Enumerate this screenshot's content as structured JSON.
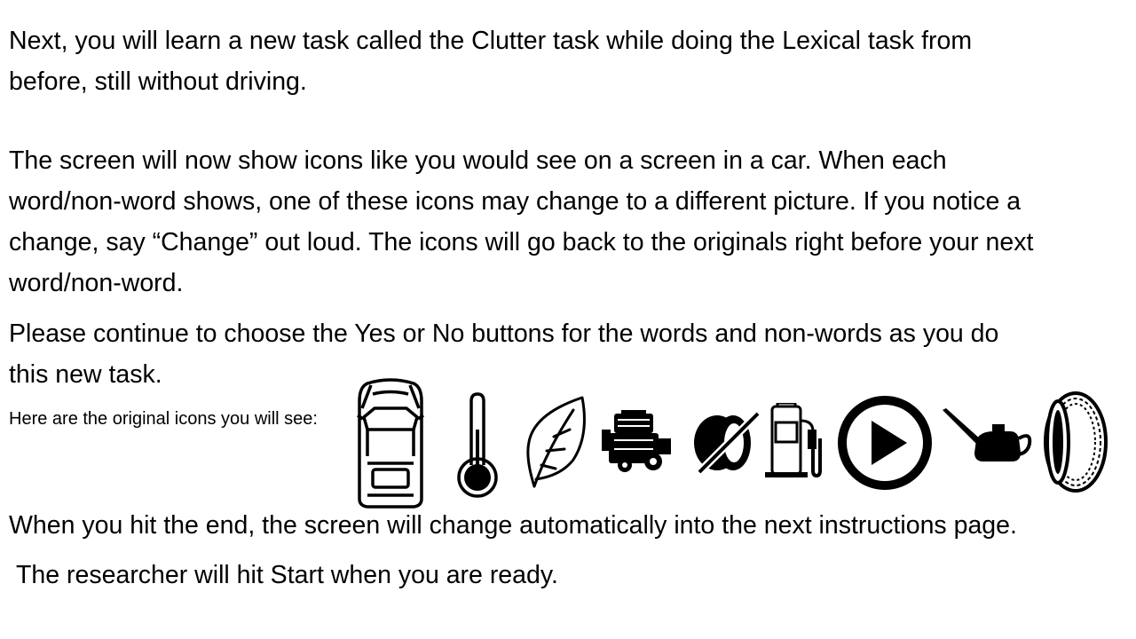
{
  "paragraphs": {
    "p1_line1": "Next, you will learn a new task called the Clutter task while doing the Lexical task from",
    "p1_line2": "before, still without driving.",
    "p2_line1": "The screen will now show icons like you would see on a screen in a car. When each",
    "p2_line2": "word/non-word shows, one of these icons may change to a different picture. If you notice a",
    "p2_line3": "change, say “Change” out loud. The icons will go back to the originals right before your next",
    "p2_line4": "word/non-word.",
    "p3_line1": "Please continue to choose the Yes or No buttons for the words and non-words as you do",
    "p3_line2": "this new task.",
    "icons_caption": "Here are the original icons you will see:",
    "p4_line1": "When you hit the end, the screen will change automatically into the next instructions page.",
    "p5_line1": "The researcher will hit Start when you are ready."
  },
  "icons": [
    "car-top-view-icon",
    "thermometer-icon",
    "leaf-icon",
    "engine-icon",
    "no-tape-icon",
    "fuel-pump-icon",
    "play-circle-icon",
    "oil-can-icon",
    "tire-icon"
  ]
}
